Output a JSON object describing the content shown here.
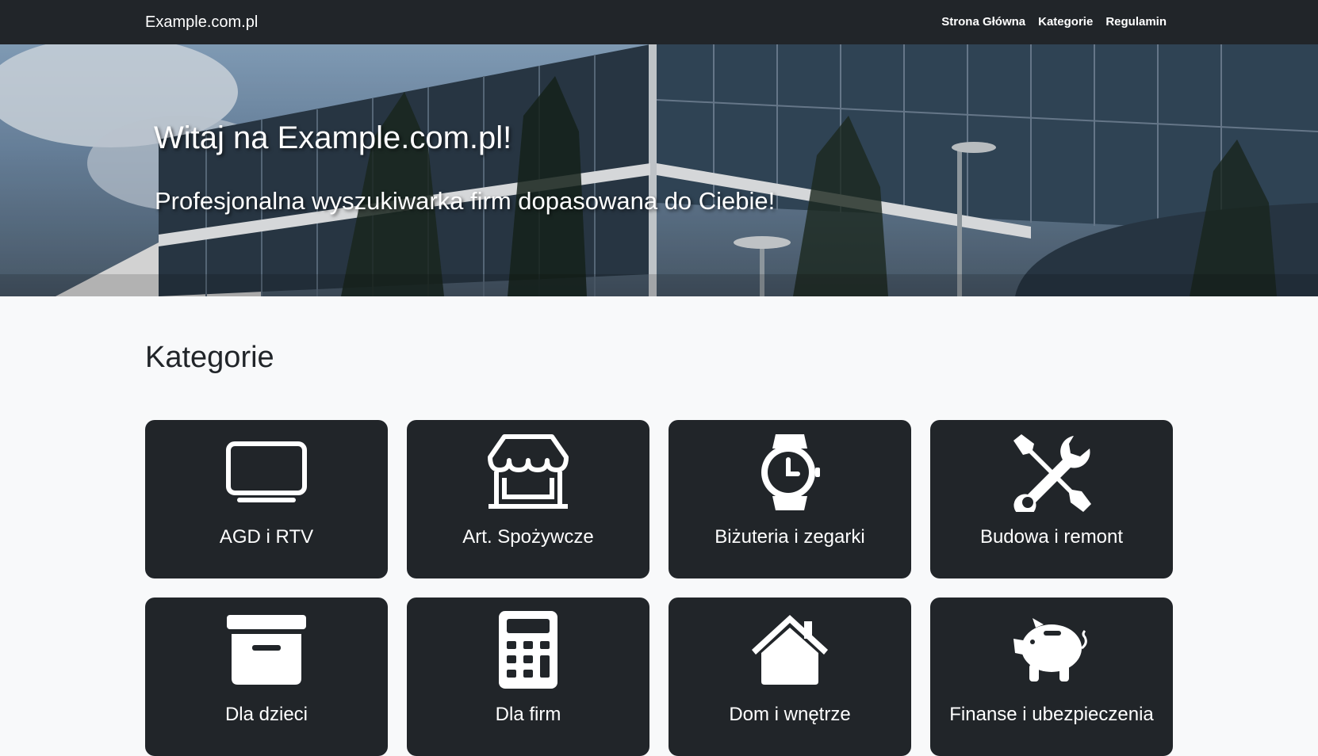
{
  "navbar": {
    "brand": "Example.com.pl",
    "links": [
      "Strona Główna",
      "Kategorie",
      "Regulamin"
    ]
  },
  "hero": {
    "title": "Witaj na Example.com.pl!",
    "subtitle": "Profesjonalna wyszukiwarka firm dopasowana do Ciebie!"
  },
  "categories": {
    "heading": "Kategorie",
    "items": [
      {
        "label": "AGD i RTV",
        "icon": "tv-icon"
      },
      {
        "label": "Art. Spożywcze",
        "icon": "shop-icon"
      },
      {
        "label": "Biżuteria i zegarki",
        "icon": "watch-icon"
      },
      {
        "label": "Budowa i remont",
        "icon": "tools-icon"
      },
      {
        "label": "Dla dzieci",
        "icon": "archive-box-icon"
      },
      {
        "label": "Dla firm",
        "icon": "calculator-icon"
      },
      {
        "label": "Dom i wnętrze",
        "icon": "house-icon"
      },
      {
        "label": "Finanse i ubezpieczenia",
        "icon": "piggy-bank-icon"
      }
    ]
  },
  "colors": {
    "navbar": "#212529",
    "card": "#212529",
    "page_background": "#f8f9fa",
    "text_light": "#ffffff"
  }
}
